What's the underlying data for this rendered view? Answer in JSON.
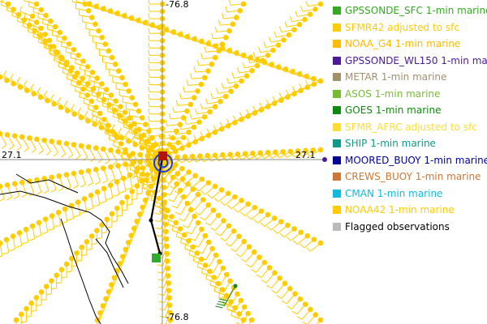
{
  "map": {
    "top_label": "-76.8",
    "bottom_label": "-76.8",
    "left_label": "27.1",
    "right_label": "27.1"
  },
  "legend": [
    {
      "label": "GPSSONDE_SFC 1-min marine",
      "color": "#33aa22"
    },
    {
      "label": "SFMR42 adjusted to sfc",
      "color": "#ffcc00"
    },
    {
      "label": "NOAA_G4 1-min marine",
      "color": "#ffbb00"
    },
    {
      "label": "GPSSONDE_WL150 1-min marine",
      "color": "#4b1a99"
    },
    {
      "label": "METAR 1-min marine",
      "color": "#a0906c"
    },
    {
      "label": "ASOS 1-min marine",
      "color": "#77bb33"
    },
    {
      "label": "GOES 1-min marine",
      "color": "#118811"
    },
    {
      "label": "SFMR_AFRC adjusted to sfc",
      "color": "#ffdd33"
    },
    {
      "label": "SHIP 1-min marine",
      "color": "#119988"
    },
    {
      "label": "MOORED_BUOY 1-min marine",
      "color": "#000099"
    },
    {
      "label": "CREWS_BUOY 1-min marine",
      "color": "#cc7733"
    },
    {
      "label": "CMAN 1-min marine",
      "color": "#11bbdd"
    },
    {
      "label": "NOAA42 1-min marine",
      "color": "#ffcc00"
    },
    {
      "label": "Flagged observations",
      "color": "#bbbbbb"
    }
  ]
}
